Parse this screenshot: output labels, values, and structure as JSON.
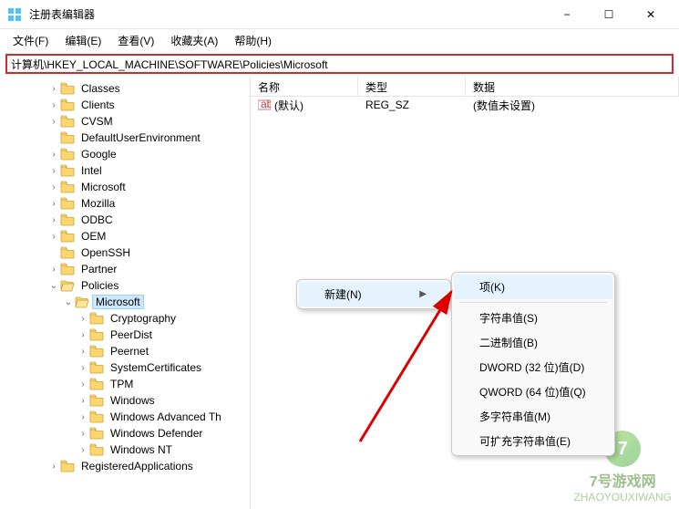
{
  "window": {
    "title": "注册表编辑器",
    "controls": {
      "min": "−",
      "max": "☐",
      "close": "✕"
    }
  },
  "menubar": [
    "文件(F)",
    "编辑(E)",
    "查看(V)",
    "收藏夹(A)",
    "帮助(H)"
  ],
  "address": "计算机\\HKEY_LOCAL_MACHINE\\SOFTWARE\\Policies\\Microsoft",
  "tree": [
    {
      "indent": 3,
      "chev": ">",
      "label": "Classes"
    },
    {
      "indent": 3,
      "chev": ">",
      "label": "Clients"
    },
    {
      "indent": 3,
      "chev": ">",
      "label": "CVSM"
    },
    {
      "indent": 3,
      "chev": "",
      "label": "DefaultUserEnvironment"
    },
    {
      "indent": 3,
      "chev": ">",
      "label": "Google"
    },
    {
      "indent": 3,
      "chev": ">",
      "label": "Intel"
    },
    {
      "indent": 3,
      "chev": ">",
      "label": "Microsoft"
    },
    {
      "indent": 3,
      "chev": ">",
      "label": "Mozilla"
    },
    {
      "indent": 3,
      "chev": ">",
      "label": "ODBC"
    },
    {
      "indent": 3,
      "chev": ">",
      "label": "OEM"
    },
    {
      "indent": 3,
      "chev": "",
      "label": "OpenSSH"
    },
    {
      "indent": 3,
      "chev": ">",
      "label": "Partner"
    },
    {
      "indent": 3,
      "chev": "v",
      "label": "Policies"
    },
    {
      "indent": 4,
      "chev": "v",
      "label": "Microsoft",
      "selected": true
    },
    {
      "indent": 5,
      "chev": ">",
      "label": "Cryptography"
    },
    {
      "indent": 5,
      "chev": ">",
      "label": "PeerDist"
    },
    {
      "indent": 5,
      "chev": ">",
      "label": "Peernet"
    },
    {
      "indent": 5,
      "chev": ">",
      "label": "SystemCertificates"
    },
    {
      "indent": 5,
      "chev": ">",
      "label": "TPM"
    },
    {
      "indent": 5,
      "chev": ">",
      "label": "Windows"
    },
    {
      "indent": 5,
      "chev": ">",
      "label": "Windows Advanced Th"
    },
    {
      "indent": 5,
      "chev": ">",
      "label": "Windows Defender"
    },
    {
      "indent": 5,
      "chev": ">",
      "label": "Windows NT"
    },
    {
      "indent": 3,
      "chev": ">",
      "label": "RegisteredApplications"
    }
  ],
  "columns": {
    "name": "名称",
    "type": "类型",
    "data": "数据"
  },
  "rows": [
    {
      "name": "(默认)",
      "type": "REG_SZ",
      "data": "(数值未设置)"
    }
  ],
  "context": {
    "parent_label": "新建(N)",
    "submenu": [
      "项(K)",
      "字符串值(S)",
      "二进制值(B)",
      "DWORD (32 位)值(D)",
      "QWORD (64 位)值(Q)",
      "多字符串值(M)",
      "可扩充字符串值(E)"
    ]
  },
  "watermark": {
    "site": "7号游戏网",
    "domain": "ZHAOYOUXIWANG"
  }
}
